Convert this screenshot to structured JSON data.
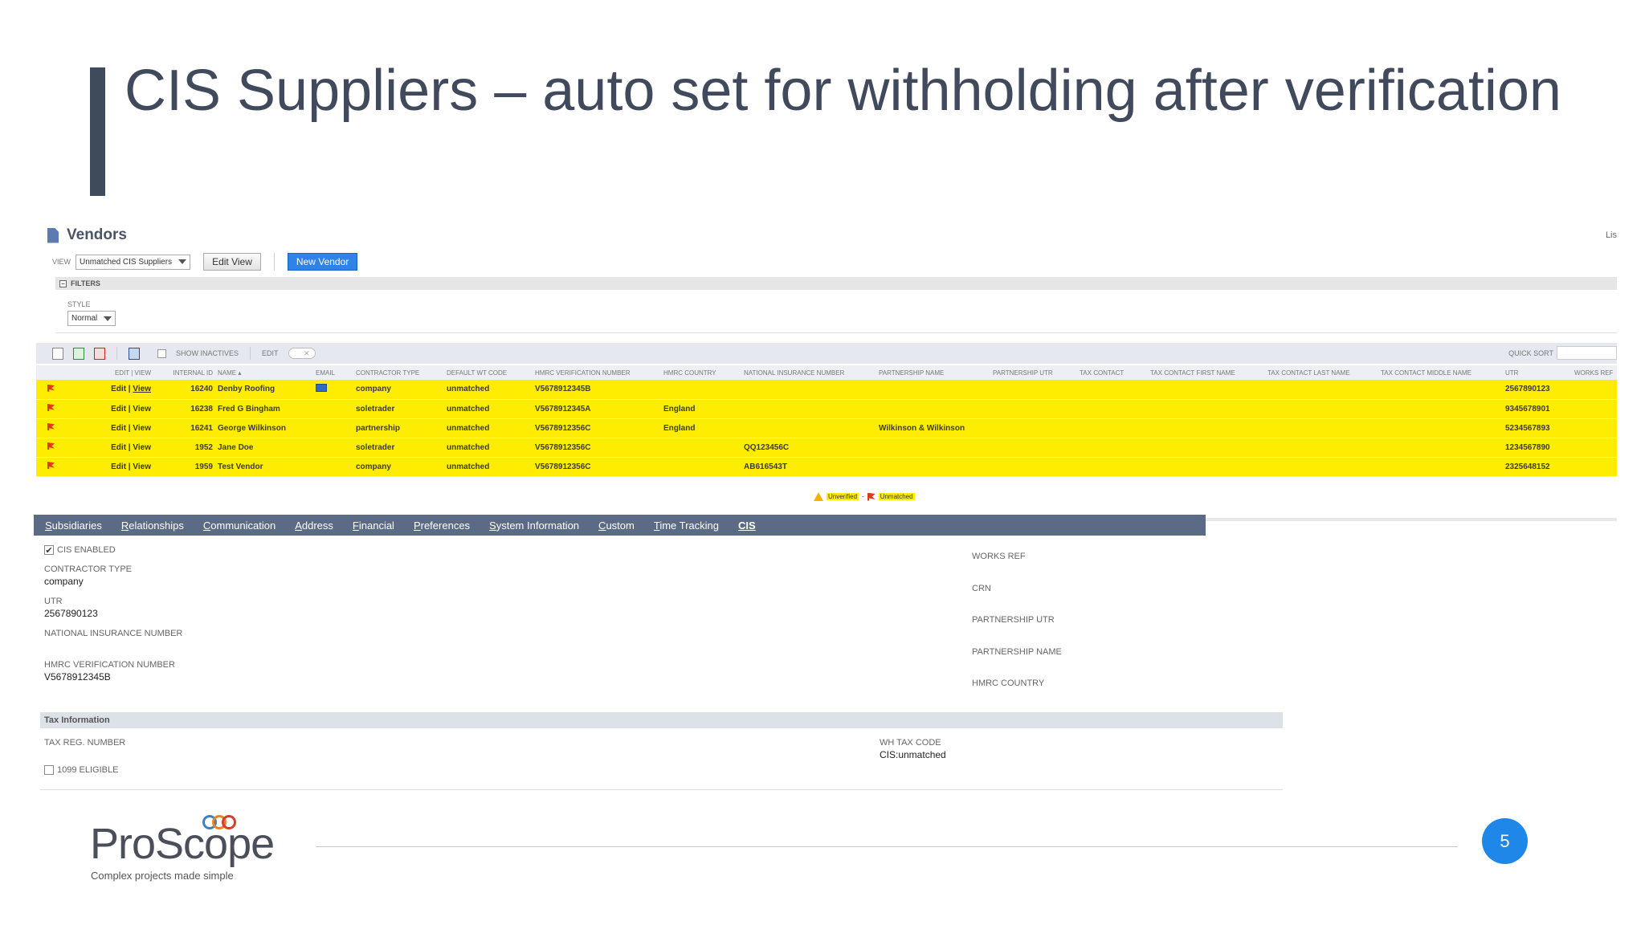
{
  "slide": {
    "title": "CIS Suppliers – auto set for withholding after verification",
    "page_number": "5"
  },
  "logo": {
    "name": "ProScope",
    "tagline": "Complex projects made simple",
    "ring_colors": [
      "#e8841f",
      "#3f7fc6",
      "#d63e2a"
    ]
  },
  "app": {
    "page_title": "Vendors",
    "list_label": "Lis",
    "view_label": "VIEW",
    "view_value": "Unmatched CIS Suppliers",
    "edit_view_button": "Edit View",
    "new_vendor_button": "New Vendor",
    "filters_label": "FILTERS",
    "style_label": "STYLE",
    "style_value": "Normal",
    "show_inactives_label": "SHOW INACTIVES",
    "edit_label": "EDIT",
    "quick_sort_label": "QUICK SORT",
    "columns": [
      "",
      "EDIT | VIEW",
      "INTERNAL ID",
      "NAME ▴",
      "EMAIL",
      "CONTRACTOR TYPE",
      "DEFAULT WT CODE",
      "HMRC VERIFICATION NUMBER",
      "HMRC COUNTRY",
      "NATIONAL INSURANCE NUMBER",
      "PARTNERSHIP NAME",
      "PARTNERSHIP UTR",
      "TAX CONTACT",
      "TAX CONTACT FIRST NAME",
      "TAX CONTACT LAST NAME",
      "TAX CONTACT MIDDLE NAME",
      "UTR",
      "WORKS REF"
    ],
    "rows": [
      {
        "edit": "Edit",
        "view": "View",
        "id": "16240",
        "name": "Denby Roofing",
        "email": true,
        "type": "company",
        "wt": "unmatched",
        "hmrc": "V5678912345B",
        "country": "",
        "ni": "",
        "pname": "",
        "utr": "2567890123"
      },
      {
        "edit": "Edit",
        "view": "View",
        "id": "16238",
        "name": "Fred G Bingham",
        "email": false,
        "type": "soletrader",
        "wt": "unmatched",
        "hmrc": "V5678912345A",
        "country": "England",
        "ni": "",
        "pname": "",
        "utr": "9345678901"
      },
      {
        "edit": "Edit",
        "view": "View",
        "id": "16241",
        "name": "George Wilkinson",
        "email": false,
        "type": "partnership",
        "wt": "unmatched",
        "hmrc": "V5678912356C",
        "country": "England",
        "ni": "",
        "pname": "Wilkinson & Wilkinson",
        "utr": "5234567893"
      },
      {
        "edit": "Edit",
        "view": "View",
        "id": "1952",
        "name": "Jane Doe",
        "email": false,
        "type": "soletrader",
        "wt": "unmatched",
        "hmrc": "V5678912356C",
        "country": "",
        "ni": "QQ123456C",
        "pname": "",
        "utr": "1234567890"
      },
      {
        "edit": "Edit",
        "view": "View",
        "id": "1959",
        "name": "Test Vendor",
        "email": false,
        "type": "company",
        "wt": "unmatched",
        "hmrc": "V5678912356C",
        "country": "",
        "ni": "AB616543T",
        "pname": "",
        "utr": "2325648152"
      }
    ],
    "legend": {
      "unverified": "Unverified",
      "dash": "-",
      "unmatched": "Unmatched"
    },
    "tabs": [
      "Subsidiaries",
      "Relationships",
      "Communication",
      "Address",
      "Financial",
      "Preferences",
      "System Information",
      "Custom",
      "Time Tracking",
      "CIS"
    ],
    "active_tab": "CIS",
    "cis": {
      "cis_enabled_label": "CIS ENABLED",
      "contractor_type_label": "CONTRACTOR TYPE",
      "contractor_type_value": "company",
      "utr_label": "UTR",
      "utr_value": "2567890123",
      "ni_label": "NATIONAL INSURANCE NUMBER",
      "hmrc_label": "HMRC VERIFICATION NUMBER",
      "hmrc_value": "V5678912345B",
      "works_ref_label": "WORKS REF",
      "crn_label": "CRN",
      "partnership_utr_label": "PARTNERSHIP UTR",
      "partnership_name_label": "PARTNERSHIP NAME",
      "hmrc_country_label": "HMRC COUNTRY"
    },
    "tax": {
      "section_label": "Tax Information",
      "tax_reg_label": "TAX REG. NUMBER",
      "eligible_label": "1099 ELIGIBLE",
      "wh_tax_code_label": "WH TAX CODE",
      "wh_tax_code_value": "CIS:unmatched"
    },
    "colors": {
      "highlight": "#ffed00",
      "tab_bar": "#5b6b86",
      "primary_button": "#2f82e8"
    }
  }
}
